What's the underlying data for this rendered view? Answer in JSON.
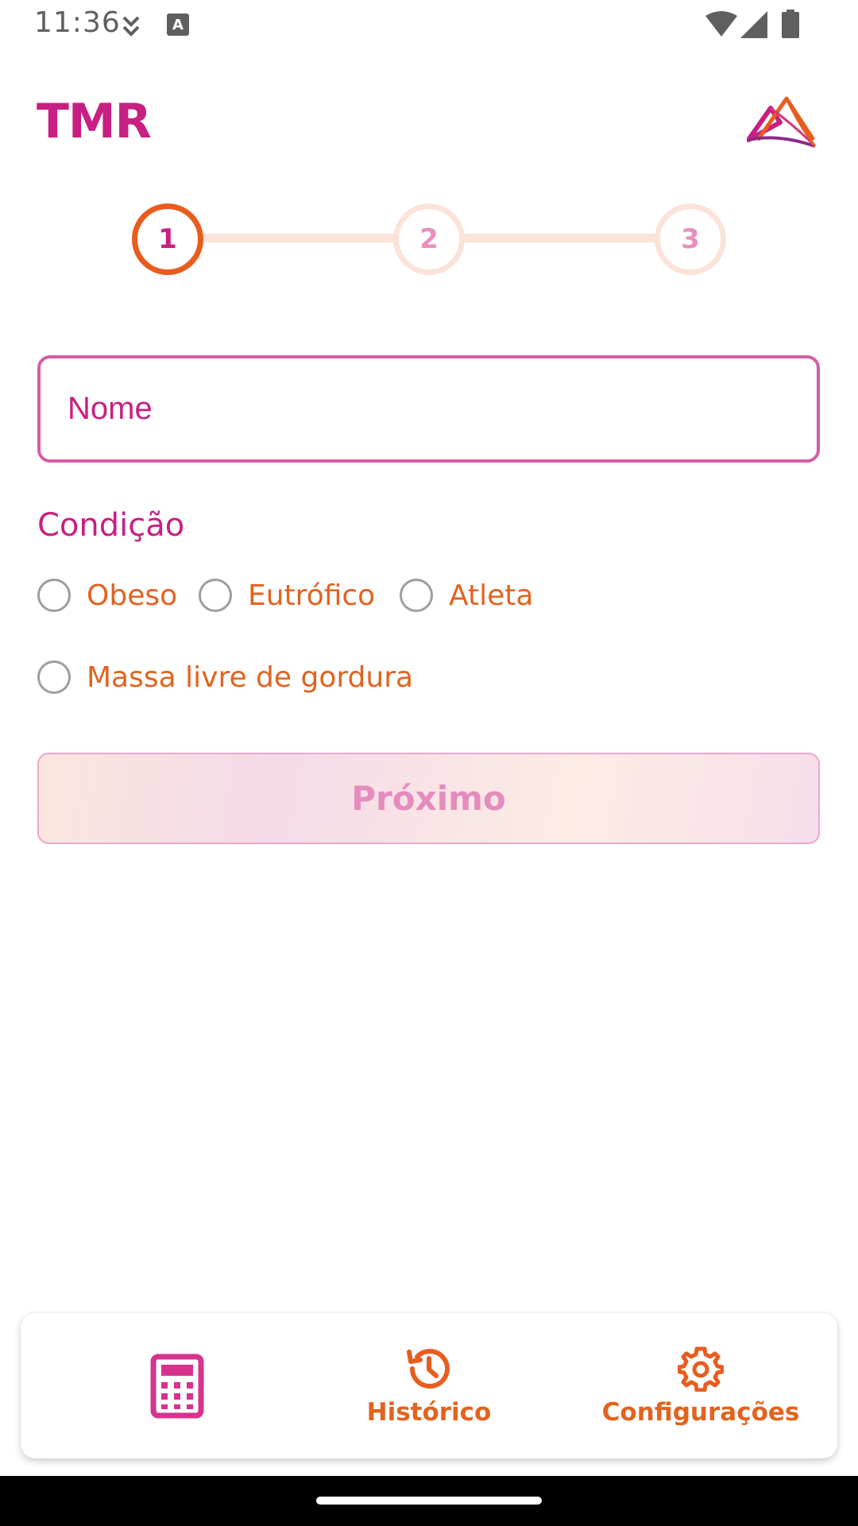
{
  "status_bar": {
    "time": "11:36"
  },
  "header": {
    "title": "TMR"
  },
  "stepper": {
    "steps": [
      "1",
      "2",
      "3"
    ],
    "active_step": 1
  },
  "form": {
    "name_placeholder": "Nome",
    "condition_label": "Condição",
    "options": [
      "Obeso",
      "Eutrófico",
      "Atleta",
      "Massa livre de gordura"
    ],
    "next_label": "Próximo"
  },
  "bottom_nav": {
    "history_label": "Histórico",
    "settings_label": "Configurações"
  },
  "colors": {
    "brand_pink": "#c81f82",
    "accent_orange": "#e85d1e",
    "step_inactive": "#fbe3da"
  },
  "icons": [
    "signal-icon",
    "wifi-icon",
    "battery-icon",
    "calculator-icon",
    "history-icon",
    "gear-icon",
    "logo-icon"
  ]
}
